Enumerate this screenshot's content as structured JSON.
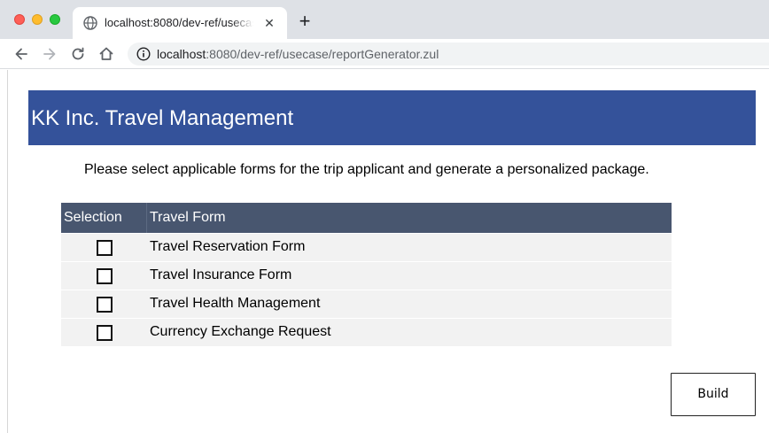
{
  "browser": {
    "tab": {
      "title": "localhost:8080/dev-ref/usecase/reportGenerator.zul",
      "favicon": "globe-icon",
      "close": "✕"
    },
    "new_tab": "+",
    "url_host": "localhost",
    "url_rest": ":8080/dev-ref/usecase/reportGenerator.zul"
  },
  "page": {
    "banner_title": "KK Inc. Travel Management",
    "banner_color": "#34529a",
    "instructions": "Please select applicable forms for the trip applicant and generate a personalized package.",
    "grid": {
      "columns": [
        "Selection",
        "Travel Form"
      ],
      "header_color": "#48566f",
      "rows": [
        {
          "label": "Travel Reservation Form",
          "checked": false
        },
        {
          "label": "Travel Insurance Form",
          "checked": false
        },
        {
          "label": "Travel Health Management",
          "checked": false
        },
        {
          "label": "Currency Exchange Request",
          "checked": false
        }
      ]
    },
    "build_label": "Build"
  }
}
